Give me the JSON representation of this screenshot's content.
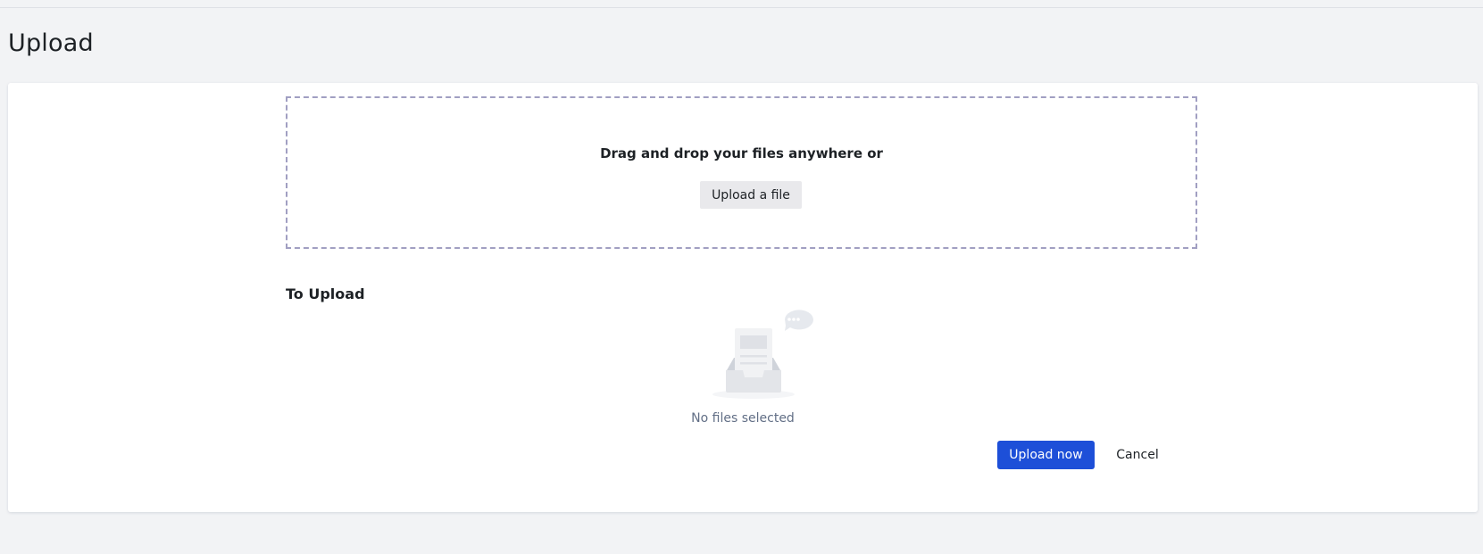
{
  "page": {
    "title": "Upload"
  },
  "dropzone": {
    "instruction": "Drag and drop your files anywhere or",
    "upload_file_label": "Upload a file"
  },
  "to_upload": {
    "heading": "To Upload",
    "empty_text": "No files selected",
    "illustration_icon": "empty-inbox-icon"
  },
  "actions": {
    "upload_now_label": "Upload now",
    "cancel_label": "Cancel"
  },
  "colors": {
    "primary": "#1d4fd8",
    "page_background": "#f2f3f5",
    "dropzone_border": "#a19fc2"
  }
}
